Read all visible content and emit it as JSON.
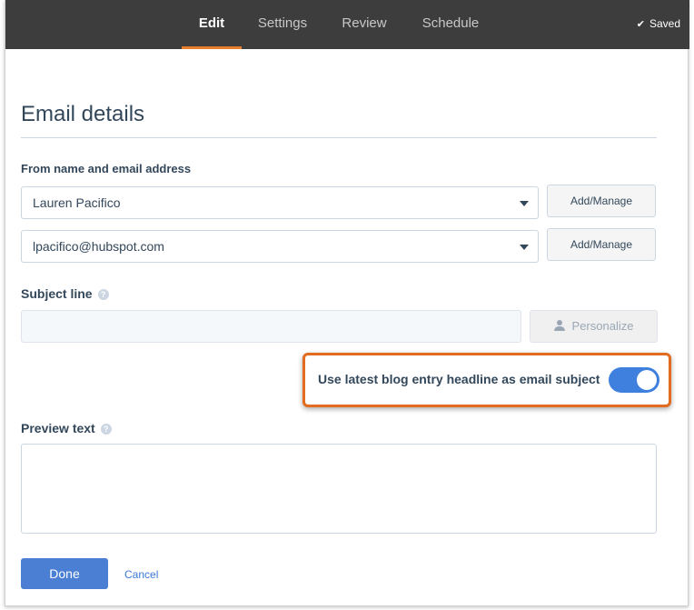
{
  "nav": {
    "tabs": [
      {
        "label": "Edit"
      },
      {
        "label": "Settings"
      },
      {
        "label": "Review"
      },
      {
        "label": "Schedule"
      }
    ],
    "saved_label": "Saved",
    "accent": "#e87d2e"
  },
  "page": {
    "title": "Email details"
  },
  "from": {
    "label": "From name and email address",
    "name_value": "Lauren Pacifico",
    "email_value": "lpacifico@hubspot.com",
    "add_manage_label": "Add/Manage"
  },
  "subject": {
    "label": "Subject line",
    "value": "",
    "personalize_label": "Personalize"
  },
  "toggle": {
    "label": "Use latest blog entry headline as email subject",
    "on": true,
    "color": "#3f80de",
    "highlight_color": "#e36b20"
  },
  "preview": {
    "label": "Preview text",
    "value": ""
  },
  "actions": {
    "done_label": "Done",
    "cancel_label": "Cancel"
  },
  "icons": {
    "saved": "check-icon",
    "help": "question-circle-icon",
    "dropdown": "caret-down-icon",
    "personalize": "person-icon"
  }
}
